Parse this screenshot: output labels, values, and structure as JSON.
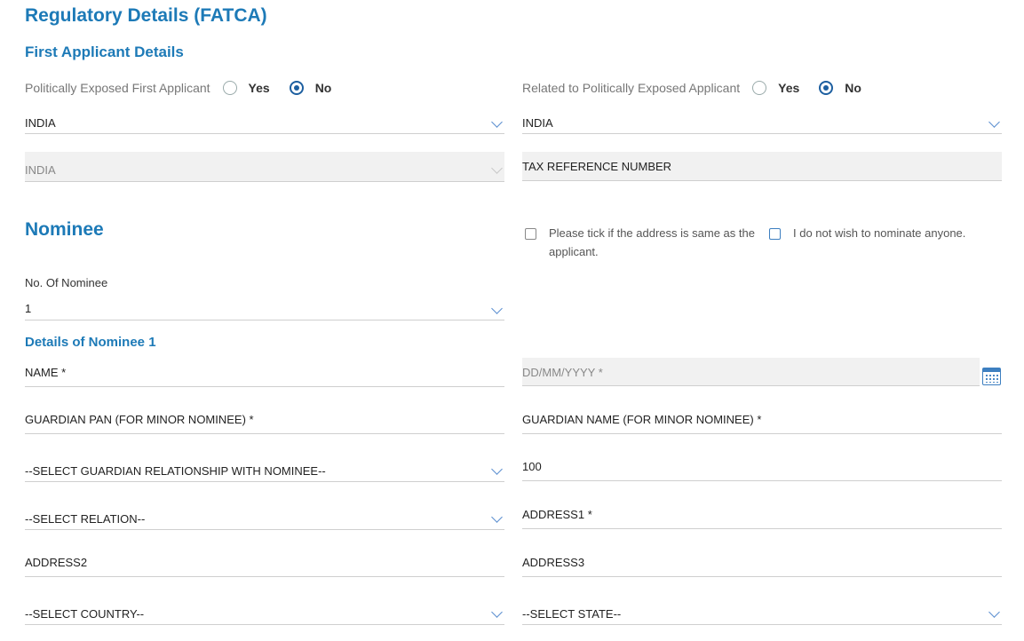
{
  "page_title": "Regulatory Details (FATCA)",
  "first_applicant": {
    "heading": "First Applicant Details",
    "pep_question": "Politically Exposed First Applicant",
    "related_question": "Related to Politically Exposed Applicant",
    "yes_label": "Yes",
    "no_label": "No",
    "pep_selected": "No",
    "related_selected": "No",
    "country_birth": "INDIA",
    "country_citizenship": "INDIA",
    "country_tax": "INDIA",
    "tax_ref_placeholder": "TAX REFERENCE NUMBER"
  },
  "nominee": {
    "heading": "Nominee",
    "same_address_label": "Please tick if the address is same as the applicant.",
    "no_nominate_label": "I do not wish to nominate anyone.",
    "count_label": "No. Of Nominee",
    "count_value": "1",
    "details_heading": "Details of Nominee 1",
    "name_placeholder": "NAME *",
    "dob_placeholder": "DD/MM/YYYY *",
    "guardian_pan_placeholder": "GUARDIAN PAN (FOR MINOR NOMINEE) *",
    "guardian_name_placeholder": "GUARDIAN NAME (FOR MINOR NOMINEE) *",
    "guardian_relationship": "--SELECT GUARDIAN RELATIONSHIP WITH NOMINEE--",
    "percentage_value": "100",
    "relation": "--SELECT RELATION--",
    "address1_placeholder": "ADDRESS1 *",
    "address2_placeholder": "ADDRESS2",
    "address3_placeholder": "ADDRESS3",
    "country": "--SELECT COUNTRY--",
    "state": "--SELECT STATE--"
  },
  "colors": {
    "heading_blue": "#1d7ab7",
    "accent_blue": "#3d7fc0"
  },
  "icons": {
    "dropdown": "chevron-down-icon",
    "calendar": "calendar-icon"
  }
}
